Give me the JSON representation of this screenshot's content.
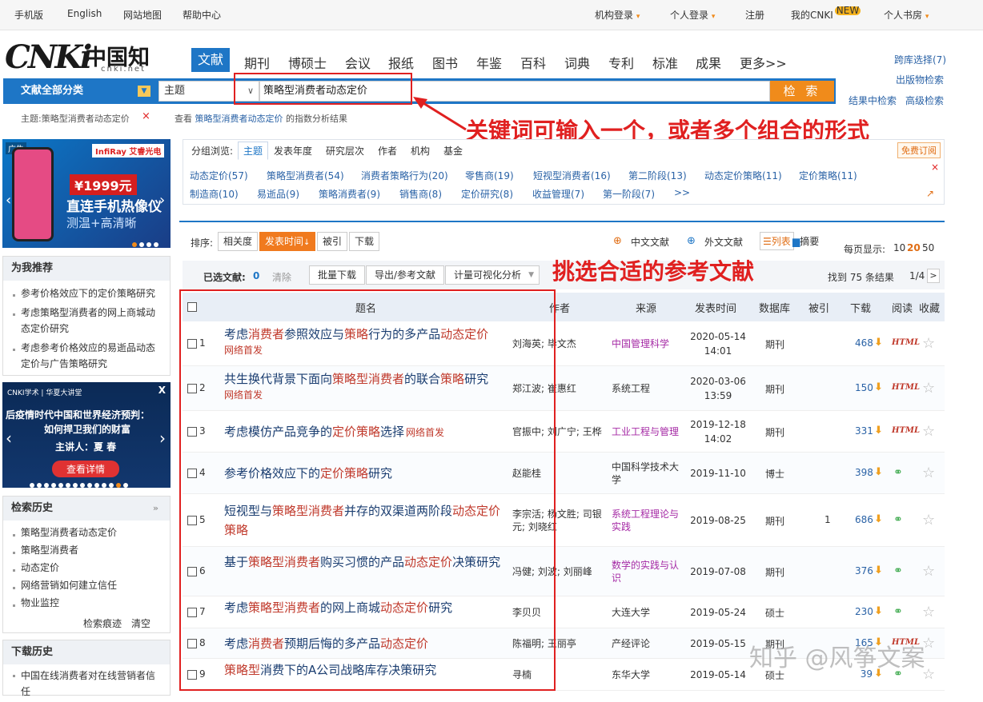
{
  "topbar": {
    "mobile": "手机版",
    "english": "English",
    "sitemap": "网站地图",
    "help": "帮助中心",
    "org_login": "机构登录",
    "personal_login": "个人登录",
    "register": "注册",
    "my_cnki": "我的CNKI",
    "new_badge": "NEW",
    "bookshelf": "个人书房"
  },
  "logo": {
    "brand": "CNKi",
    "zh": "中国知网",
    "url": "cnki.net"
  },
  "nav": {
    "tabs": [
      "文献",
      "期刊",
      "博硕士",
      "会议",
      "报纸",
      "图书",
      "年鉴",
      "百科",
      "词典",
      "专利",
      "标准",
      "成果",
      "更多>>"
    ]
  },
  "search": {
    "category": "文献全部分类",
    "field": "主题",
    "keyword": "策略型消费者动态定价",
    "button": "检 索"
  },
  "right_links": {
    "cross_db": "跨库选择(7)",
    "publications": "出版物检索",
    "within_results": "结果中检索",
    "advanced": "高级检索"
  },
  "hints": {
    "current": "主题:策略型消费者动态定价",
    "close": "×",
    "view_prefix": "查看",
    "view_link": "策略型消费者动态定价",
    "view_suffix": "的指数分析结果"
  },
  "annotations": {
    "keyword_note": "关键词可输入一个，或者多个组合的形式",
    "select_note": "挑选合适的参考文献"
  },
  "ads": {
    "ad1_label": "广告",
    "ad1_brand": "InfiRay 艾睿光电",
    "ad1_price": "¥1999元",
    "ad1_line1": "直连手机热像仪",
    "ad1_line2": "测温+高清晰",
    "ad2_brand": "CNKI学术 | 华夏大讲堂",
    "ad2_line1": "后疫情时代中国和世界经济预判：",
    "ad2_line2": "如何捍卫我们的财富",
    "ad2_speaker": "主讲人：夏 春",
    "ad2_btn": "查看详情",
    "ad2_close": "X"
  },
  "recommend": {
    "title": "为我推荐",
    "items": [
      "参考价格效应下的定价策略研究",
      "考虑策略型消费者的网上商城动态定价研究",
      "考虑参考价格效应的易逝品动态定价与广告策略研究"
    ]
  },
  "history": {
    "title": "检索历史",
    "items": [
      "策略型消费者动态定价",
      "策略型消费者",
      "动态定价",
      "网络营销如何建立信任",
      "物业监控"
    ],
    "trace": "检索痕迹",
    "clear": "清空"
  },
  "download_history": {
    "title": "下载历史",
    "items": [
      "中国在线消费者对在线营销者信任"
    ]
  },
  "group": {
    "label": "分组浏览:",
    "tabs": [
      "主题",
      "发表年度",
      "研究层次",
      "作者",
      "机构",
      "基金"
    ],
    "subscribe": "免费订阅",
    "row1": [
      "动态定价(57)",
      "策略型消费者(54)",
      "消费者策略行为(20)",
      "零售商(19)",
      "短视型消费者(16)",
      "第二阶段(13)",
      "动态定价策略(11)",
      "定价策略(11)"
    ],
    "row2": [
      "制造商(10)",
      "易逝品(9)",
      "策略消费者(9)",
      "销售商(8)",
      "定价研究(8)",
      "收益管理(7)",
      "第一阶段(7)",
      ">>"
    ]
  },
  "sort": {
    "label": "排序:",
    "options": [
      "相关度",
      "发表时间",
      "被引",
      "下载"
    ],
    "zh_docs": "中文文献",
    "foreign_docs": "外文文献",
    "list": "列表",
    "abstract": "摘要",
    "per_page_label": "每页显示:",
    "per_page": [
      "10",
      "20",
      "50"
    ]
  },
  "selection": {
    "selected_label": "已选文献:",
    "selected_count": "0",
    "clear": "清除",
    "batch": "批量下载",
    "export": "导出/参考文献",
    "visual": "计量可视化分析",
    "found": "找到 75 条结果",
    "page": "1/4",
    "next": ">"
  },
  "table": {
    "headers": [
      "题名",
      "作者",
      "来源",
      "发表时间",
      "数据库",
      "被引",
      "下载",
      "阅读",
      "收藏"
    ],
    "rows": [
      {
        "n": "1",
        "title": "考虑消费者参照效应与策略行为的多产品动态定价",
        "net": "网络首发",
        "authors": "刘海英; 毕文杰",
        "source": "中国管理科学",
        "mag": true,
        "date": "2020-05-14 14:01",
        "db": "期刊",
        "cited": "",
        "dl": "468",
        "read": "HTML"
      },
      {
        "n": "2",
        "title": "共生换代背景下面向策略型消费者的联合策略研究",
        "net": "网络首发",
        "authors": "郑江波; 崔惠红",
        "source": "系统工程",
        "mag": false,
        "date": "2020-03-06 13:59",
        "db": "期刊",
        "cited": "",
        "dl": "150",
        "read": "HTML"
      },
      {
        "n": "3",
        "title": "考虑模仿产品竞争的定价策略选择",
        "net": "网络首发",
        "authors": "官振中; 刘广宁; 王桦",
        "source": "工业工程与管理",
        "mag": true,
        "date": "2019-12-18 14:02",
        "db": "期刊",
        "cited": "",
        "dl": "331",
        "read": "HTML"
      },
      {
        "n": "4",
        "title": "参考价格效应下的定价策略研究",
        "net": "",
        "authors": "赵能桂",
        "source": "中国科学技术大学",
        "mag": false,
        "date": "2019-11-10",
        "db": "博士",
        "cited": "",
        "dl": "398",
        "read": "book"
      },
      {
        "n": "5",
        "title": "短视型与策略型消费者并存的双渠道两阶段动态定价策略",
        "net": "",
        "authors": "李宗活; 杨文胜; 司银元; 刘晓红",
        "source": "系统工程理论与实践",
        "mag": true,
        "date": "2019-08-25",
        "db": "期刊",
        "cited": "1",
        "dl": "686",
        "read": "book"
      },
      {
        "n": "6",
        "title": "基于策略型消费者购买习惯的产品动态定价决策研究",
        "net": "",
        "authors": "冯健; 刘波; 刘丽峰",
        "source": "数学的实践与认识",
        "mag": true,
        "date": "2019-07-08",
        "db": "期刊",
        "cited": "",
        "dl": "376",
        "read": "book"
      },
      {
        "n": "7",
        "title": "考虑策略型消费者的网上商城动态定价研究",
        "net": "",
        "authors": "李贝贝",
        "source": "大连大学",
        "mag": false,
        "date": "2019-05-24",
        "db": "硕士",
        "cited": "",
        "dl": "230",
        "read": "book"
      },
      {
        "n": "8",
        "title": "考虑消费者预期后悔的多产品动态定价",
        "net": "",
        "authors": "陈福明; 王丽亭",
        "source": "产经评论",
        "mag": false,
        "date": "2019-05-15",
        "db": "期刊",
        "cited": "",
        "dl": "165",
        "read": "HTML"
      },
      {
        "n": "9",
        "title": "策略型消费下的A公司战略库存决策研究",
        "net": "",
        "authors": "寻楠",
        "source": "东华大学",
        "mag": false,
        "date": "2019-05-14",
        "db": "硕士",
        "cited": "",
        "dl": "39",
        "read": "book"
      }
    ]
  },
  "watermark": "知乎 @风筝文案",
  "colors": {
    "brand_blue": "#1e76c6",
    "search_orange": "#f08b1b",
    "highlight_red": "#c0392b",
    "annot_red": "#e02020"
  }
}
